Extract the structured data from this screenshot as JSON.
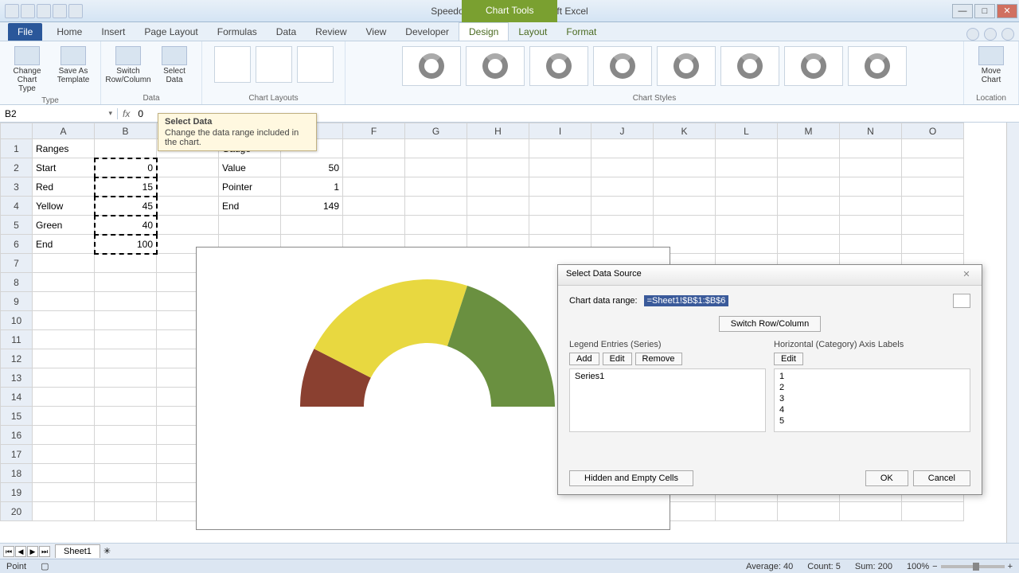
{
  "window": {
    "title": "Speedometer_2010 - Microsoft Excel",
    "chart_tools": "Chart Tools"
  },
  "tabs": {
    "file": "File",
    "home": "Home",
    "insert": "Insert",
    "page_layout": "Page Layout",
    "formulas": "Formulas",
    "data": "Data",
    "review": "Review",
    "view": "View",
    "developer": "Developer",
    "design": "Design",
    "layout": "Layout",
    "format": "Format"
  },
  "ribbon": {
    "type": {
      "change": "Change Chart Type",
      "saveas": "Save As Template",
      "group": "Type"
    },
    "data": {
      "switch": "Switch Row/Column",
      "select": "Select Data",
      "group": "Data"
    },
    "layouts": {
      "group": "Chart Layouts"
    },
    "styles": {
      "group": "Chart Styles"
    },
    "location": {
      "move": "Move Chart",
      "group": "Location"
    }
  },
  "tooltip": {
    "title": "Select Data",
    "body": "Change the data range included in the chart."
  },
  "namebox": "B2",
  "formula": "0",
  "columns": [
    "A",
    "B",
    "C",
    "D",
    "E",
    "F",
    "G",
    "H",
    "I",
    "J",
    "K",
    "L",
    "M",
    "N",
    "O"
  ],
  "cells": {
    "A1": "Ranges",
    "D1": "Gauge",
    "A2": "Start",
    "B2": "0",
    "D2": "Value",
    "E2": "50",
    "A3": "Red",
    "B3": "15",
    "D3": "Pointer",
    "E3": "1",
    "A4": "Yellow",
    "B4": "45",
    "D4": "End",
    "E4": "149",
    "A5": "Green",
    "B5": "40",
    "A6": "End",
    "B6": "100"
  },
  "legend": [
    "1",
    "2",
    "3",
    "4",
    "5"
  ],
  "legend_colors": [
    "#4a6a9a",
    "#8a3030",
    "#d8c840",
    "#6a9040",
    "#ffffff"
  ],
  "dialog": {
    "title": "Select Data Source",
    "range_label": "Chart data range:",
    "range_value": "=Sheet1!$B$1:$B$6",
    "switch": "Switch Row/Column",
    "legend_hd": "Legend Entries (Series)",
    "axis_hd": "Horizontal (Category) Axis Labels",
    "add": "Add",
    "edit": "Edit",
    "remove": "Remove",
    "edit2": "Edit",
    "series": [
      "Series1"
    ],
    "cats": [
      "1",
      "2",
      "3",
      "4",
      "5"
    ],
    "hidden": "Hidden and Empty Cells",
    "ok": "OK",
    "cancel": "Cancel"
  },
  "sheet": {
    "name": "Sheet1"
  },
  "status": {
    "mode": "Point",
    "avg_lbl": "Average:",
    "avg": "40",
    "cnt_lbl": "Count:",
    "cnt": "5",
    "sum_lbl": "Sum:",
    "sum": "200",
    "zoom": "100%"
  },
  "chart_data": {
    "type": "pie",
    "title": "",
    "categories": [
      "Start",
      "Red",
      "Yellow",
      "Green",
      "End"
    ],
    "values": [
      0,
      15,
      45,
      40,
      100
    ],
    "colors": [
      "#4a6a9a",
      "#8a3030",
      "#d8c840",
      "#6a9040",
      "transparent"
    ],
    "note": "Doughnut semicircle gauge; End slice (100) hidden to create half-ring"
  }
}
